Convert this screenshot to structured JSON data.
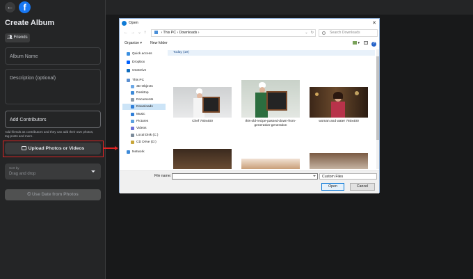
{
  "facebook": {
    "logo_letter": "f",
    "panel_title": "Create Album",
    "privacy_label": "Friends",
    "album_name_placeholder": "Album Name",
    "description_placeholder": "Description (optional)",
    "add_contributors_label": "Add Contributors",
    "contributors_helper": "Add friends as contributors and they can add their own photos, tag posts and more.",
    "upload_label": "Upload Photos or Videos",
    "sort_label": "Sort by",
    "sort_value": "Drag and drop",
    "use_date_label": "Use Date from Photos"
  },
  "dialog": {
    "title": "Open",
    "address": {
      "segments": [
        "This PC",
        "Downloads"
      ],
      "separator": "›"
    },
    "search_placeholder": "Search Downloads",
    "toolbar": {
      "organize": "Organize ▾",
      "new_folder": "New folder"
    },
    "sidebar": [
      {
        "label": "Quick access",
        "icon": "star-icon",
        "color": "#3b8fe0"
      },
      {
        "label": "Dropbox",
        "icon": "dropbox-icon",
        "color": "#0061fe"
      },
      {
        "label": "OneDrive",
        "icon": "cloud-icon",
        "color": "#0f6cbd"
      },
      {
        "label": "This PC",
        "icon": "computer-icon",
        "color": "#5a8fd0"
      },
      {
        "label": "3D Objects",
        "icon": "cube-icon",
        "color": "#6aa7e6"
      },
      {
        "label": "Desktop",
        "icon": "desktop-icon",
        "color": "#3d8ad8"
      },
      {
        "label": "Documents",
        "icon": "document-icon",
        "color": "#8c9aa8"
      },
      {
        "label": "Downloads",
        "icon": "download-icon",
        "color": "#2f7ed8"
      },
      {
        "label": "Music",
        "icon": "music-icon",
        "color": "#2f7ed8"
      },
      {
        "label": "Pictures",
        "icon": "picture-icon",
        "color": "#5aa0e0"
      },
      {
        "label": "Videos",
        "icon": "video-icon",
        "color": "#6a6fd8"
      },
      {
        "label": "Local Disk (C:)",
        "icon": "drive-icon",
        "color": "#7a8a9a"
      },
      {
        "label": "CD Drive (D:)",
        "icon": "cd-icon",
        "color": "#c8a63a"
      },
      {
        "label": "Network",
        "icon": "network-icon",
        "color": "#3d8ad8"
      }
    ],
    "group_header": "Today (19)",
    "files": [
      {
        "name": "Chef 780x400"
      },
      {
        "name": "this-old-recipe-passed-down-from-generation-generation"
      },
      {
        "name": "woman and water 780x400"
      }
    ],
    "file_name_label": "File name:",
    "file_type": "Custom Files",
    "open_label": "Open",
    "cancel_label": "Cancel"
  }
}
